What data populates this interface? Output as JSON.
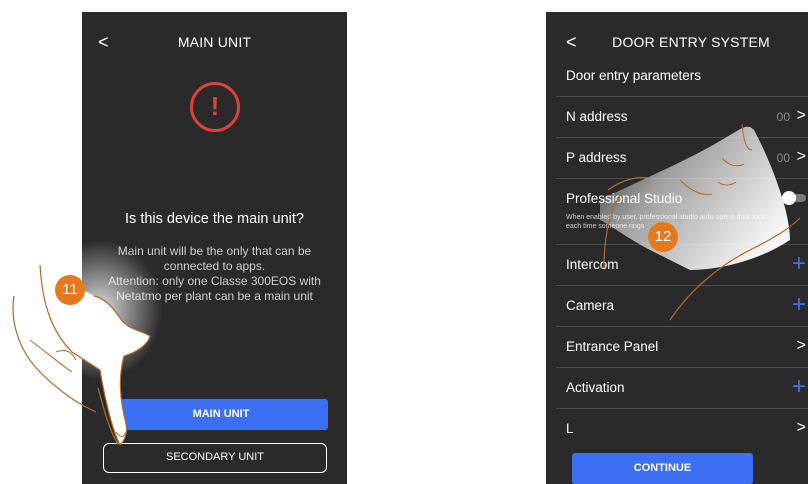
{
  "left_screen": {
    "back_icon": "chevron-left-icon",
    "title": "MAIN UNIT",
    "alert_icon": "exclamation-circle-icon",
    "alert_glyph": "!",
    "question": "Is this device the main unit?",
    "description_lines": [
      "Main unit will be the only that can be",
      "connected to apps.",
      "Attention: only one Classe 300EOS with",
      "Netatmo per plant can be a main unit"
    ],
    "primary_button": "MAIN UNIT",
    "secondary_button": "SECONDARY UNIT",
    "step_badge": "11"
  },
  "right_screen": {
    "back_icon": "chevron-left-icon",
    "title": "DOOR ENTRY SYSTEM",
    "section_label": "Door entry parameters",
    "rows": [
      {
        "label": "N address",
        "value": "00",
        "action": "chevron-right-icon"
      },
      {
        "label": "P address",
        "value": "00",
        "action": "chevron-right-icon"
      },
      {
        "label": "Professional Studio",
        "action": "toggle-switch",
        "toggle_on": false,
        "sublabel": "When enabled by user, professional studio auto opens door lock each time someone rings"
      },
      {
        "label": "Intercom",
        "action": "plus-icon"
      },
      {
        "label": "Camera",
        "action": "plus-icon"
      },
      {
        "label": "Entrance Panel",
        "action": "chevron-right-icon"
      },
      {
        "label": "Activation",
        "action": "plus-icon"
      },
      {
        "label": "L",
        "action": "chevron-right-icon"
      }
    ],
    "continue_button": "CONTINUE",
    "step_badge": "12"
  },
  "glyphs": {
    "chevron_left": "<",
    "chevron_right": ">",
    "plus": "+"
  },
  "colors": {
    "accent_blue": "#3d6ff5",
    "alert_red": "#e0403a",
    "step_orange": "#e6791e",
    "screen_bg": "#2a2a2a"
  }
}
